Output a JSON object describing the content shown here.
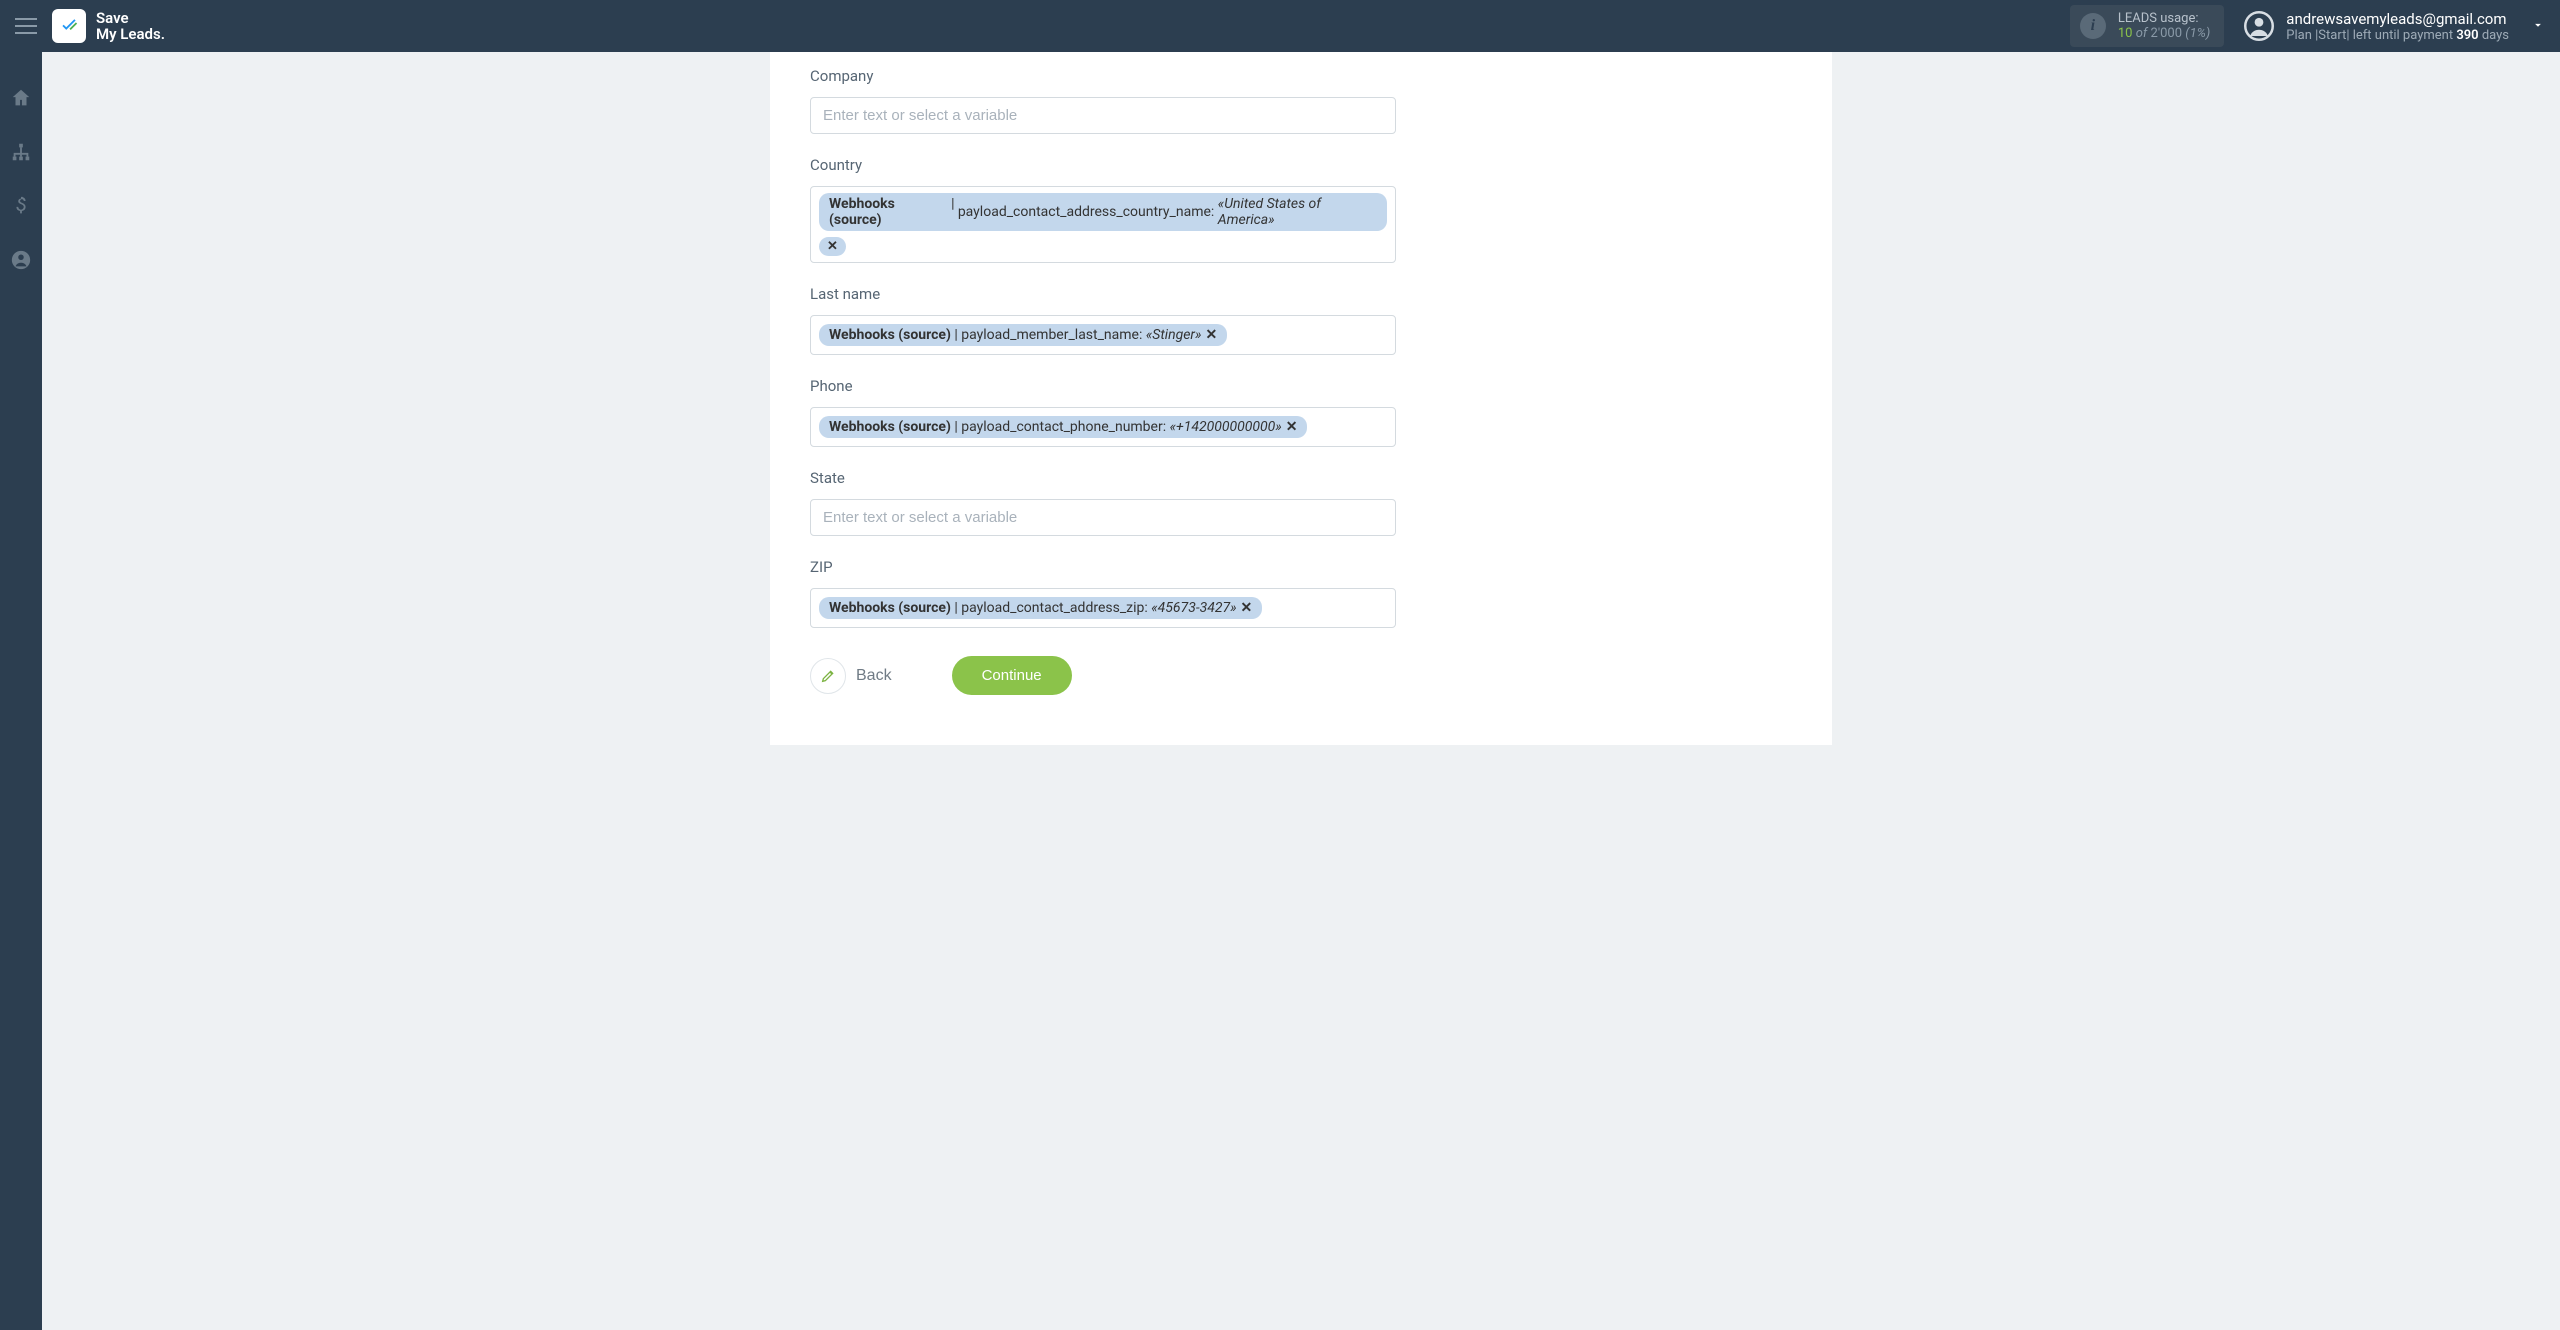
{
  "header": {
    "logo_line1": "Save",
    "logo_line2": "My Leads.",
    "usage_label": "LEADS usage:",
    "usage_current": "10",
    "usage_of": "of",
    "usage_total": "2'000",
    "usage_percent": "(1%)",
    "user_email": "andrewsavemyleads@gmail.com",
    "plan_prefix": "Plan |Start| left until payment",
    "plan_days_num": "390",
    "plan_days_word": "days"
  },
  "form": {
    "source_label": "Webhooks (source)",
    "placeholder": "Enter text or select a variable",
    "fields": {
      "company": {
        "label": "Company"
      },
      "country": {
        "label": "Country",
        "payload": "payload_contact_address_country_name:",
        "example": "«United States of America»"
      },
      "last_name": {
        "label": "Last name",
        "payload": "payload_member_last_name:",
        "example": "«Stinger»"
      },
      "phone": {
        "label": "Phone",
        "payload": "payload_contact_phone_number:",
        "example": "«+142000000000»"
      },
      "state": {
        "label": "State"
      },
      "zip": {
        "label": "ZIP",
        "payload": "payload_contact_address_zip:",
        "example": "«45673-3427»"
      }
    }
  },
  "actions": {
    "back": "Back",
    "continue": "Continue"
  }
}
